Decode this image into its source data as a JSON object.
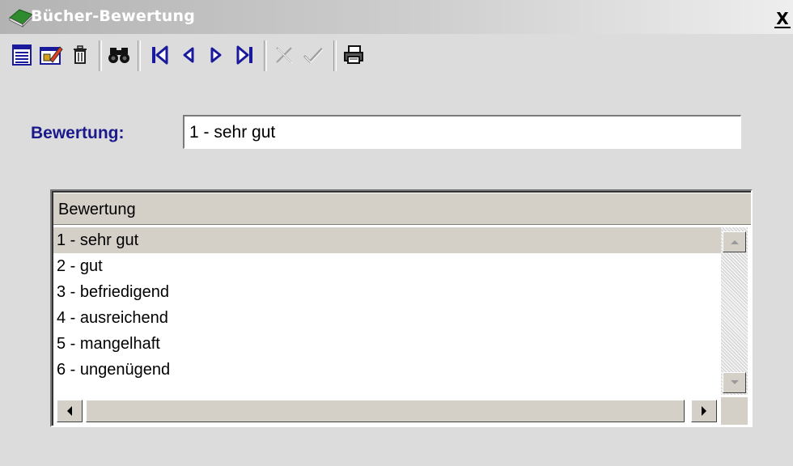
{
  "window": {
    "title": "Bücher-Bewertung",
    "close_label": "X"
  },
  "toolbar": {
    "buttons": [
      {
        "name": "new-record",
        "icon": "form-list-icon"
      },
      {
        "name": "edit-record",
        "icon": "edit-pencil-icon"
      },
      {
        "name": "delete-record",
        "icon": "trash-icon"
      },
      {
        "name": "search",
        "icon": "binoculars-icon"
      },
      {
        "name": "first-record",
        "icon": "first-record-icon"
      },
      {
        "name": "previous-record",
        "icon": "previous-icon"
      },
      {
        "name": "next-record",
        "icon": "next-icon"
      },
      {
        "name": "last-record",
        "icon": "last-record-icon"
      },
      {
        "name": "cancel",
        "icon": "cross-icon"
      },
      {
        "name": "confirm",
        "icon": "checkmark-icon"
      },
      {
        "name": "print",
        "icon": "printer-icon"
      }
    ]
  },
  "form": {
    "label": "Bewertung:",
    "value": "1 - sehr gut"
  },
  "grid": {
    "column_header": "Bewertung",
    "rows": [
      {
        "text": "1 - sehr gut",
        "selected": true
      },
      {
        "text": "2 - gut",
        "selected": false
      },
      {
        "text": "3 - befriedigend",
        "selected": false
      },
      {
        "text": "4 - ausreichend",
        "selected": false
      },
      {
        "text": "5 - mangelhaft",
        "selected": false
      },
      {
        "text": "6 - ungenügend",
        "selected": false
      }
    ]
  },
  "colors": {
    "label": "#1a1a8c",
    "selection": "#d4d0c8",
    "toolbar_icon_blue": "#1a1a9c"
  }
}
